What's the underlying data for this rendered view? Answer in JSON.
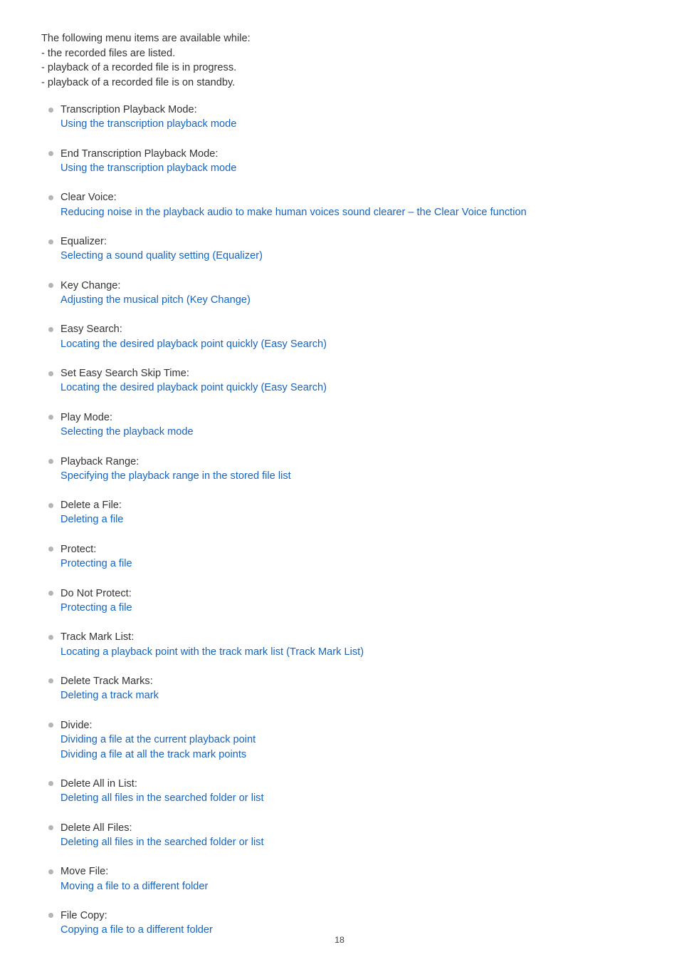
{
  "page": {
    "background_color": "#ffffff",
    "text_color": "#333333",
    "link_color": "#1565c0",
    "bullet_color": "#b4b4b4",
    "page_number": "18"
  },
  "intro": {
    "lines": [
      "The following menu items are available while:",
      "- the recorded files are listed.",
      "- playback of a recorded file is in progress.",
      "- playback of a recorded file is on standby."
    ]
  },
  "menu_items": [
    {
      "title": "Transcription Playback Mode:",
      "links": [
        "Using the transcription playback mode"
      ]
    },
    {
      "title": "End Transcription Playback Mode:",
      "links": [
        "Using the transcription playback mode"
      ]
    },
    {
      "title": "Clear Voice:",
      "links": [
        "Reducing noise in the playback audio to make human voices sound clearer – the Clear Voice function"
      ]
    },
    {
      "title": "Equalizer:",
      "links": [
        "Selecting a sound quality setting (Equalizer)"
      ]
    },
    {
      "title": "Key Change:",
      "links": [
        "Adjusting the musical pitch (Key Change)"
      ]
    },
    {
      "title": "Easy Search:",
      "links": [
        "Locating the desired playback point quickly (Easy Search)"
      ]
    },
    {
      "title": "Set Easy Search Skip Time:",
      "links": [
        "Locating the desired playback point quickly (Easy Search)"
      ]
    },
    {
      "title": "Play Mode:",
      "links": [
        "Selecting the playback mode"
      ]
    },
    {
      "title": "Playback Range:",
      "links": [
        "Specifying the playback range in the stored file list"
      ]
    },
    {
      "title": "Delete a File:",
      "links": [
        "Deleting a file"
      ]
    },
    {
      "title": "Protect:",
      "links": [
        "Protecting a file"
      ]
    },
    {
      "title": "Do Not Protect:",
      "links": [
        "Protecting a file"
      ]
    },
    {
      "title": "Track Mark List:",
      "links": [
        "Locating a playback point with the track mark list (Track Mark List)"
      ]
    },
    {
      "title": "Delete Track Marks:",
      "links": [
        "Deleting a track mark"
      ]
    },
    {
      "title": "Divide:",
      "links": [
        "Dividing a file at the current playback point",
        "Dividing a file at all the track mark points"
      ]
    },
    {
      "title": "Delete All in List:",
      "links": [
        "Deleting all files in the searched folder or list"
      ]
    },
    {
      "title": "Delete All Files:",
      "links": [
        "Deleting all files in the searched folder or list"
      ]
    },
    {
      "title": "Move File:",
      "links": [
        "Moving a file to a different folder"
      ]
    },
    {
      "title": "File Copy:",
      "links": [
        "Copying a file to a different folder"
      ]
    }
  ]
}
